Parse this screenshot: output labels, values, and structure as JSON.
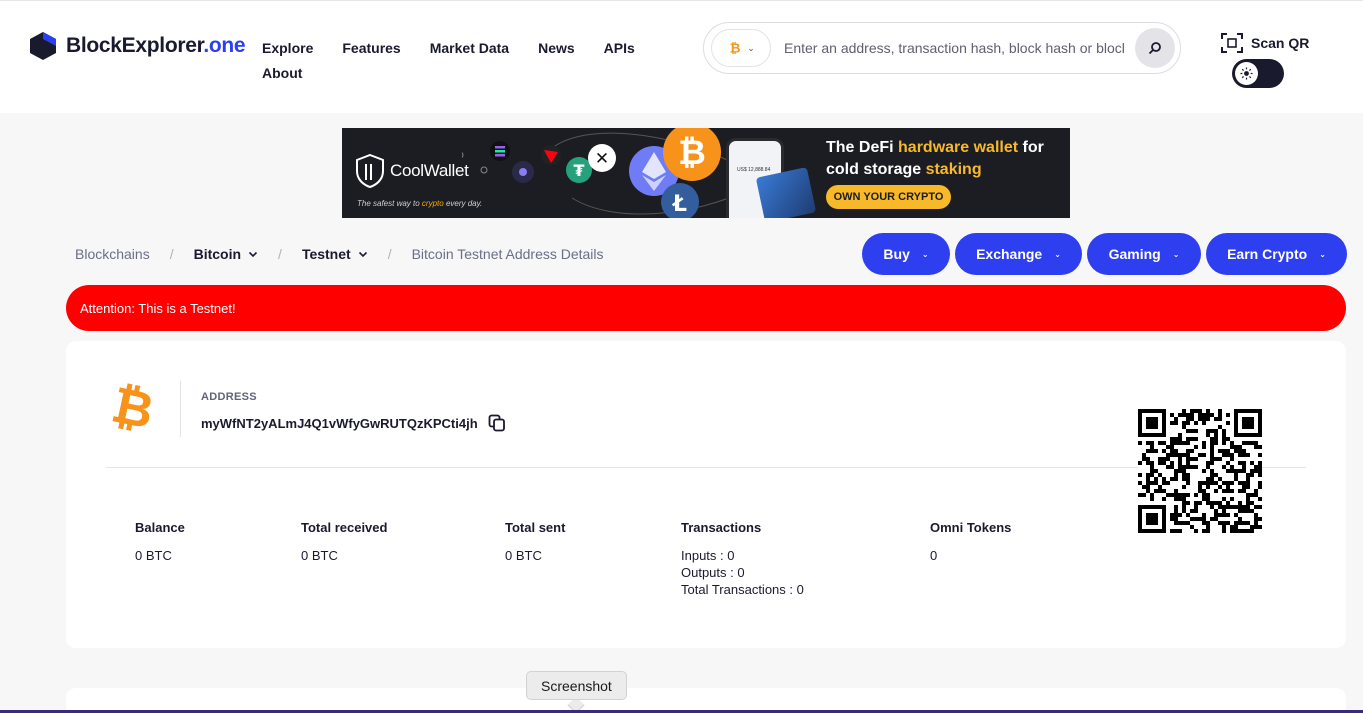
{
  "brand": {
    "name_main": "BlockExplorer",
    "name_accent": ".one"
  },
  "nav": {
    "explore": "Explore",
    "features": "Features",
    "market_data": "Market Data",
    "news": "News",
    "apis": "APIs",
    "about": "About"
  },
  "search": {
    "placeholder": "Enter an address, transaction hash, block hash or block number",
    "coin_icon": "bitcoin-icon"
  },
  "scan_qr": {
    "label": "Scan QR"
  },
  "banner": {
    "brand": "CoolWallet",
    "tagline_before": "The safest way to ",
    "tagline_highlight": "crypto",
    "tagline_after": " every day.",
    "head_1": "The DeFi ",
    "head_hl_1": "hardware wallet",
    "head_2": " for cold storage ",
    "head_hl_2": "staking",
    "cta": "OWN YOUR CRYPTO",
    "phone_amount": "US$ 12,888.84"
  },
  "breadcrumb": {
    "root": "Blockchains",
    "chain": "Bitcoin",
    "network": "Testnet",
    "current": "Bitcoin Testnet Address Details"
  },
  "cta_buttons": {
    "buy": "Buy",
    "exchange": "Exchange",
    "gaming": "Gaming",
    "earn": "Earn Crypto"
  },
  "alert": {
    "text": "Attention: This is a Testnet!"
  },
  "address": {
    "label": "ADDRESS",
    "value": "myWfNT2yALmJ4Q1vWfyGwRUTQzKPCti4jh"
  },
  "stats": {
    "balance": {
      "label": "Balance",
      "value": "0 BTC"
    },
    "received": {
      "label": "Total received",
      "value": "0 BTC"
    },
    "sent": {
      "label": "Total sent",
      "value": "0 BTC"
    },
    "transactions": {
      "label": "Transactions",
      "inputs": "Inputs : 0",
      "outputs": "Outputs : 0",
      "total": "Total Transactions : 0"
    },
    "omni": {
      "label": "Omni Tokens",
      "value": "0"
    }
  },
  "tooltip": {
    "text": "Screenshot"
  },
  "colors": {
    "accent": "#2e3ff0",
    "bitcoin": "#f7931a",
    "alert": "#ff0000",
    "banner_gold": "#f7b82a"
  }
}
